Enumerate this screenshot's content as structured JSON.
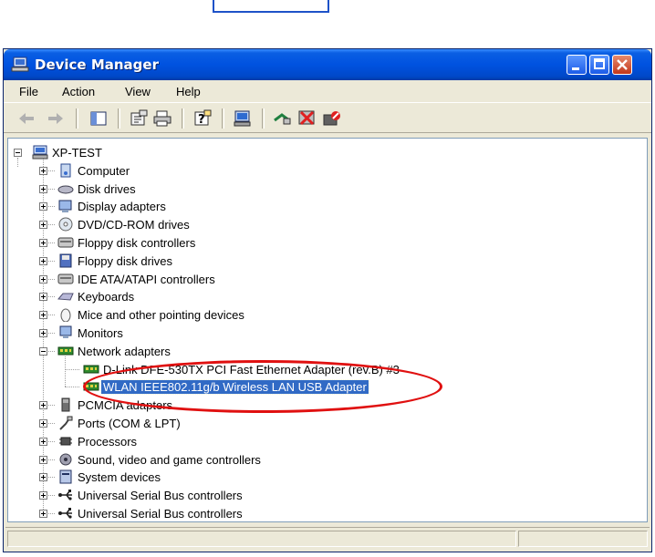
{
  "window": {
    "title": "Device Manager",
    "colors": {
      "titlebar": "#0052e0",
      "selection": "#316ac5",
      "annotation": "#e01010"
    }
  },
  "menu": [
    "File",
    "Action",
    "View",
    "Help"
  ],
  "toolbar_icons": [
    "back-arrow-icon",
    "forward-arrow-icon",
    "show-hide-tree-icon",
    "properties-icon",
    "print-icon",
    "help-icon",
    "scan-hardware-icon",
    "update-driver-icon",
    "uninstall-icon",
    "disable-icon"
  ],
  "tree": {
    "root": "XP-TEST",
    "items": [
      {
        "label": "Computer",
        "icon": "computer-icon",
        "expanded": false
      },
      {
        "label": "Disk drives",
        "icon": "disk-drive-icon",
        "expanded": false
      },
      {
        "label": "Display adapters",
        "icon": "display-adapter-icon",
        "expanded": false
      },
      {
        "label": "DVD/CD-ROM drives",
        "icon": "cdrom-icon",
        "expanded": false
      },
      {
        "label": "Floppy disk controllers",
        "icon": "controller-icon",
        "expanded": false
      },
      {
        "label": "Floppy disk drives",
        "icon": "floppy-icon",
        "expanded": false
      },
      {
        "label": "IDE ATA/ATAPI controllers",
        "icon": "controller-icon",
        "expanded": false
      },
      {
        "label": "Keyboards",
        "icon": "keyboard-icon",
        "expanded": false
      },
      {
        "label": "Mice and other pointing devices",
        "icon": "mouse-icon",
        "expanded": false
      },
      {
        "label": "Monitors",
        "icon": "monitor-icon",
        "expanded": false
      },
      {
        "label": "Network adapters",
        "icon": "network-adapter-icon",
        "expanded": true,
        "children": [
          {
            "label": "D-Link DFE-530TX PCI Fast Ethernet Adapter (rev.B) #3",
            "icon": "network-card-icon",
            "selected": false
          },
          {
            "label": "WLAN IEEE802.11g/b Wireless LAN USB Adapter",
            "icon": "network-card-icon",
            "selected": true
          }
        ]
      },
      {
        "label": "PCMCIA adapters",
        "icon": "pcmcia-icon",
        "expanded": false
      },
      {
        "label": "Ports (COM & LPT)",
        "icon": "port-icon",
        "expanded": false
      },
      {
        "label": "Processors",
        "icon": "processor-icon",
        "expanded": false
      },
      {
        "label": "Sound, video and game controllers",
        "icon": "sound-icon",
        "expanded": false
      },
      {
        "label": "System devices",
        "icon": "system-device-icon",
        "expanded": false
      },
      {
        "label": "Universal Serial Bus controllers",
        "icon": "usb-icon",
        "expanded": false
      },
      {
        "label": "Universal Serial Bus controllers",
        "icon": "usb-icon",
        "expanded": false
      }
    ]
  }
}
